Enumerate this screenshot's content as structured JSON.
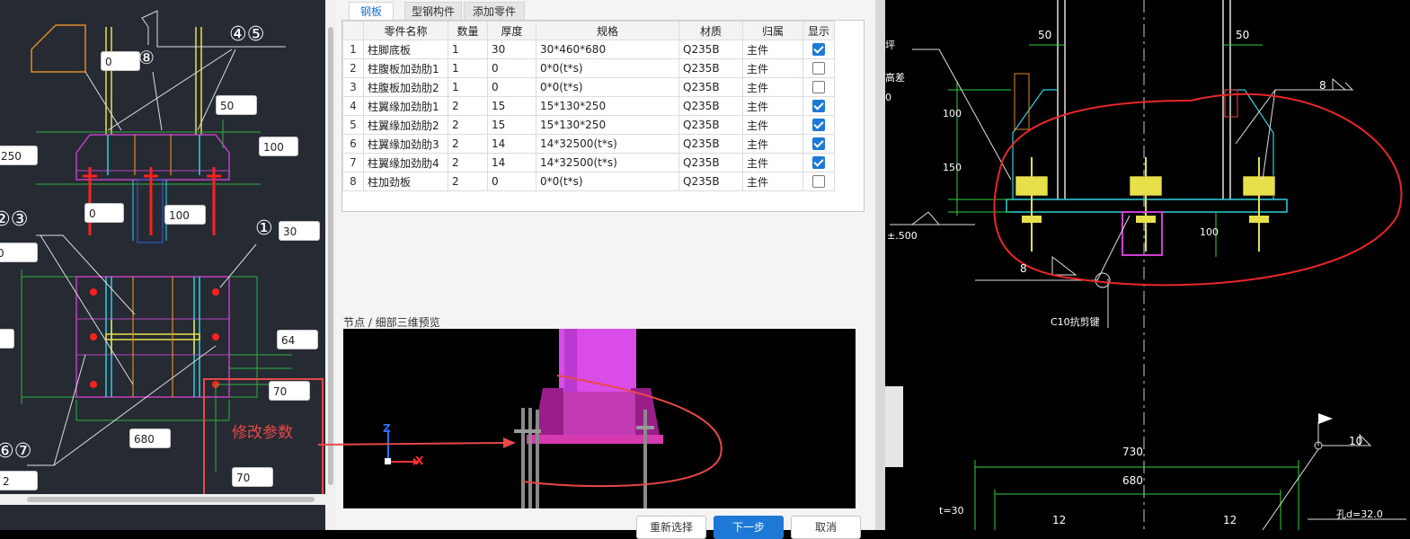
{
  "left_panel": {
    "inputs": [
      "0",
      "50",
      "100",
      "250",
      "0",
      "100",
      "30",
      "0",
      "64",
      "70",
      "680",
      "70",
      "2"
    ],
    "callouts": [
      "⑧",
      "④⑤",
      "①",
      "②③",
      "⑥⑦"
    ],
    "annotation": "修改参数"
  },
  "dialog": {
    "tabs": [
      "钢板",
      "型钢构件",
      "添加零件"
    ],
    "table": {
      "headers": [
        "",
        "零件名称",
        "数量",
        "厚度",
        "规格",
        "材质",
        "归属",
        "显示"
      ],
      "rows": [
        {
          "n": "1",
          "name": "柱脚底板",
          "qty": "1",
          "thk": "30",
          "spec": "30*460*680",
          "mat": "Q235B",
          "own": "主件",
          "show": true
        },
        {
          "n": "2",
          "name": "柱腹板加劲肋1",
          "qty": "1",
          "thk": "0",
          "spec": "0*0(t*s)",
          "mat": "Q235B",
          "own": "主件",
          "show": false
        },
        {
          "n": "3",
          "name": "柱腹板加劲肋2",
          "qty": "1",
          "thk": "0",
          "spec": "0*0(t*s)",
          "mat": "Q235B",
          "own": "主件",
          "show": false
        },
        {
          "n": "4",
          "name": "柱翼缘加劲肋1",
          "qty": "2",
          "thk": "15",
          "spec": "15*130*250",
          "mat": "Q235B",
          "own": "主件",
          "show": true
        },
        {
          "n": "5",
          "name": "柱翼缘加劲肋2",
          "qty": "2",
          "thk": "15",
          "spec": "15*130*250",
          "mat": "Q235B",
          "own": "主件",
          "show": true
        },
        {
          "n": "6",
          "name": "柱翼缘加劲肋3",
          "qty": "2",
          "thk": "14",
          "spec": "14*32500(t*s)",
          "mat": "Q235B",
          "own": "主件",
          "show": true
        },
        {
          "n": "7",
          "name": "柱翼缘加劲肋4",
          "qty": "2",
          "thk": "14",
          "spec": "14*32500(t*s)",
          "mat": "Q235B",
          "own": "主件",
          "show": true
        },
        {
          "n": "8",
          "name": "柱加劲板",
          "qty": "2",
          "thk": "0",
          "spec": "0*0(t*s)",
          "mat": "Q235B",
          "own": "主件",
          "show": false
        }
      ]
    },
    "preview_title": "节点 / 细部三维预览",
    "axis_z": "Z",
    "axis_x": "X",
    "buttons": {
      "reselect": "重新选择",
      "next": "下一步",
      "cancel": "取消"
    }
  },
  "right_cad": {
    "dims": [
      "50",
      "50",
      "8",
      "100",
      "150",
      "100",
      "8",
      "730",
      "680",
      "12",
      "12",
      "10"
    ],
    "labels": {
      "c10": "C10抗剪键",
      "elev": "±.500",
      "t30": "t=30",
      "hole": "孔d=32.0",
      "side1": "坪",
      "side2": "高差",
      "side3": "0"
    }
  },
  "colors": {
    "accent": "#1e78d6",
    "annotation": "#e84848",
    "cad_bg": "#252a33"
  }
}
